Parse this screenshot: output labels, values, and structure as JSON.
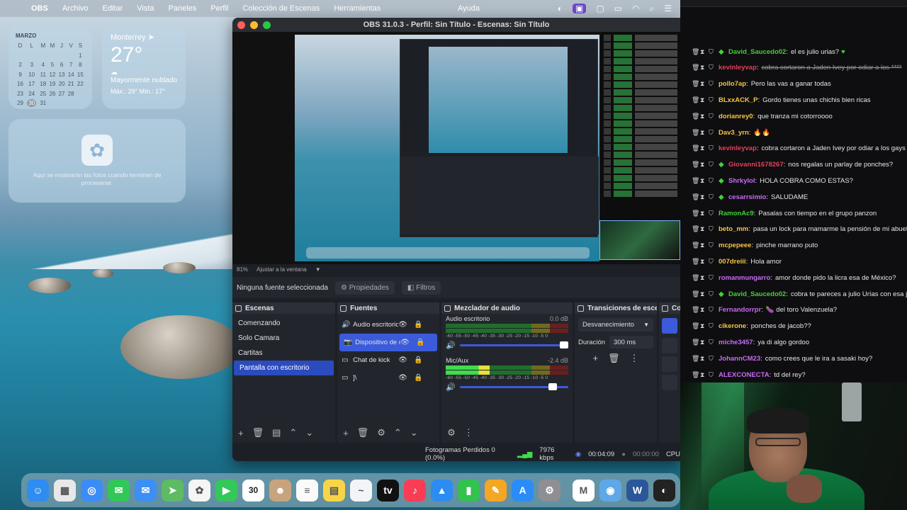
{
  "menubar": {
    "app": "OBS",
    "items": [
      "Archivo",
      "Editar",
      "Vista",
      "Paneles",
      "Perfil",
      "Colección de Escenas",
      "Herramientas"
    ],
    "help": "Ayuda"
  },
  "widgets": {
    "calendar": {
      "month": "MARZO",
      "weekdays": [
        "D",
        "L",
        "M",
        "M",
        "J",
        "V",
        "S"
      ],
      "weeks": [
        [
          "",
          "",
          "",
          "",
          "",
          "",
          "1"
        ],
        [
          "2",
          "3",
          "4",
          "5",
          "6",
          "7",
          "8"
        ],
        [
          "9",
          "10",
          "11",
          "12",
          "13",
          "14",
          "15"
        ],
        [
          "16",
          "17",
          "18",
          "19",
          "20",
          "21",
          "22"
        ],
        [
          "23",
          "24",
          "25",
          "26",
          "27",
          "28",
          ""
        ],
        [
          "29",
          "30",
          "31",
          "",
          "",
          "",
          ""
        ]
      ],
      "today": "30"
    },
    "weather": {
      "city": "Monterrey",
      "temp": "27°",
      "condition": "Mayormente nublado",
      "range": "Máx.: 29° Mín.: 17°"
    },
    "photos": {
      "text": "Aquí se mostrarán las fotos cuando terminen de procesarse."
    }
  },
  "obs": {
    "title": "OBS 31.0.3 - Perfil: Sin Título - Escenas: Sin Título",
    "zoom": "81%",
    "fit_label": "Ajustar a la ventana",
    "no_source": "Ninguna fuente seleccionada",
    "properties_label": "Propiedades",
    "filters_label": "Filtros",
    "docks": {
      "scenes": {
        "title": "Escenas",
        "items": [
          "Comenzando",
          "Solo Camara",
          "Cartitas",
          "Pantalla con escritorio"
        ],
        "selected_index": 3
      },
      "sources": {
        "title": "Fuentes",
        "items": [
          {
            "icon": "speaker-icon",
            "label": "Audio escritorio"
          },
          {
            "icon": "camera-icon",
            "label": "Dispositivo de c"
          },
          {
            "icon": "window-icon",
            "label": "Chat de kick"
          },
          {
            "icon": "monitor-icon",
            "label": "]\\"
          }
        ],
        "selected_index": 1
      },
      "mixer": {
        "title": "Mezclador de audio",
        "channels": [
          {
            "name": "Audio escritorio",
            "db": "0.0 dB",
            "level": 0
          },
          {
            "name": "Mic/Aux",
            "db": "-2.4 dB",
            "level": 0.36
          }
        ],
        "scale": "-60 -55 -50 -45 -40 -35 -30 -25 -20 -15 -10 -5 0"
      },
      "transitions": {
        "title": "Transiciones de esce...",
        "transition": "Desvanecimiento",
        "duration_label": "Duración",
        "duration": "300 ms"
      },
      "controls": {
        "title": "Co"
      }
    },
    "status": {
      "dropped": "Fotogramas Perdidos 0 (0.0%)",
      "bitrate": "7976 kbps",
      "stream_time": "00:04:09",
      "rec_time": "00:00:00",
      "cpu": "CPU"
    }
  },
  "dock_apps": [
    {
      "name": "finder-icon",
      "color": "#2f8cf0",
      "glyph": "☺"
    },
    {
      "name": "launchpad-icon",
      "color": "#e8e8e8",
      "glyph": "▦"
    },
    {
      "name": "safari-icon",
      "color": "#3b8cf6",
      "glyph": "◎"
    },
    {
      "name": "messages-icon",
      "color": "#32c759",
      "glyph": "✉"
    },
    {
      "name": "mail-icon",
      "color": "#3c8ff5",
      "glyph": "✉"
    },
    {
      "name": "maps-icon",
      "color": "#5dbb63",
      "glyph": "➤"
    },
    {
      "name": "photos-icon",
      "color": "#f5f5f5",
      "glyph": "✿"
    },
    {
      "name": "facetime-icon",
      "color": "#34c759",
      "glyph": "▶"
    },
    {
      "name": "calendar-icon",
      "color": "#ffffff",
      "glyph": "30"
    },
    {
      "name": "contacts-icon",
      "color": "#c8a47e",
      "glyph": "☻"
    },
    {
      "name": "reminders-icon",
      "color": "#fafafa",
      "glyph": "≡"
    },
    {
      "name": "notes-icon",
      "color": "#f8d548",
      "glyph": "▤"
    },
    {
      "name": "freeform-icon",
      "color": "#f2f4f7",
      "glyph": "~"
    },
    {
      "name": "apple-tv-icon",
      "color": "#111111",
      "glyph": "tv"
    },
    {
      "name": "music-icon",
      "color": "#fa3c55",
      "glyph": "♪"
    },
    {
      "name": "keynote-icon",
      "color": "#2d8cf0",
      "glyph": "▲"
    },
    {
      "name": "numbers-icon",
      "color": "#33c14f",
      "glyph": "▮"
    },
    {
      "name": "pages-icon",
      "color": "#f5a623",
      "glyph": "✎"
    },
    {
      "name": "app-store-icon",
      "color": "#2b8cf7",
      "glyph": "A"
    },
    {
      "name": "system-settings-icon",
      "color": "#8e8e93",
      "glyph": "⚙"
    },
    {
      "name": "gmail-icon",
      "color": "#ffffff",
      "glyph": "M"
    },
    {
      "name": "disk-utility-icon",
      "color": "#5ea8e8",
      "glyph": "◉"
    },
    {
      "name": "word-icon",
      "color": "#2b579a",
      "glyph": "W"
    },
    {
      "name": "obs-icon",
      "color": "#222222",
      "glyph": "◐"
    }
  ],
  "chat": [
    {
      "user": "David_Saucedo02",
      "color": "#43d13a",
      "gem": true,
      "msg": "el es julio urias?",
      "heart": true
    },
    {
      "user": "kevinleyvap",
      "color": "#e0415c",
      "gem": false,
      "msg": "cobra cortaron a Jaden Ivey por odiar a los ****",
      "strike": true
    },
    {
      "user": "pollo7ap",
      "color": "#f6c543",
      "gem": false,
      "msg": "Pero las vas a ganar todas"
    },
    {
      "user": "BLxxACK_P",
      "color": "#f6c543",
      "gem": false,
      "msg": "Gordo tienes unas chichis bien ricas"
    },
    {
      "user": "dorianrey0",
      "color": "#f6c543",
      "gem": false,
      "msg": "que tranza mi cotorroooo"
    },
    {
      "user": "Dav3_yrn",
      "color": "#f6c543",
      "gem": false,
      "msg": "🔥🔥"
    },
    {
      "user": "kevinleyvap",
      "color": "#e0415c",
      "gem": false,
      "msg": "cobra cortaron a Jaden Ivey por odiar a los gays"
    },
    {
      "user": "Giovanni1678267",
      "color": "#e0415c",
      "gem": true,
      "msg": "nos regalas un parlay de ponches?"
    },
    {
      "user": "Shrkylol",
      "color": "#c86bf5",
      "gem": true,
      "msg": "HOLA COBRA COMO ESTAS?"
    },
    {
      "user": "cesarrsimio",
      "color": "#c86bf5",
      "gem": true,
      "msg": "SALUDAME"
    },
    {
      "user": "RamonAc9",
      "color": "#43d13a",
      "gem": false,
      "msg": "Pasalas con tiempo en el grupo panzon"
    },
    {
      "user": "beto_mm",
      "color": "#f6c543",
      "gem": false,
      "msg": "pasa un lock para mamarme la pensión de mi abuel"
    },
    {
      "user": "mcpepeee",
      "color": "#f6c543",
      "gem": false,
      "msg": "pinche marrano puto"
    },
    {
      "user": "007dreiii",
      "color": "#f6c543",
      "gem": false,
      "msg": "Hola amor"
    },
    {
      "user": "romanmungarro",
      "color": "#c86bf5",
      "gem": false,
      "msg": "amor donde pido la licra esa de México?"
    },
    {
      "user": "David_Saucedo02",
      "color": "#43d13a",
      "gem": true,
      "msg": "cobra te pareces a julio Urías con esa j"
    },
    {
      "user": "Fernandorrpr",
      "color": "#c86bf5",
      "gem": false,
      "msg": "🍆 del toro Valenzuela?"
    },
    {
      "user": "cikerone",
      "color": "#f6c543",
      "gem": false,
      "msg": "ponches de jacob??"
    },
    {
      "user": "miche3457",
      "color": "#c86bf5",
      "gem": false,
      "msg": "ya di algo gordoo"
    },
    {
      "user": "JohannCM23",
      "color": "#c86bf5",
      "gem": false,
      "msg": "como crees que le ira a sasaki hoy?"
    },
    {
      "user": "ALEXCONECTA",
      "color": "#c86bf5",
      "gem": false,
      "msg": "td del rey?"
    }
  ]
}
